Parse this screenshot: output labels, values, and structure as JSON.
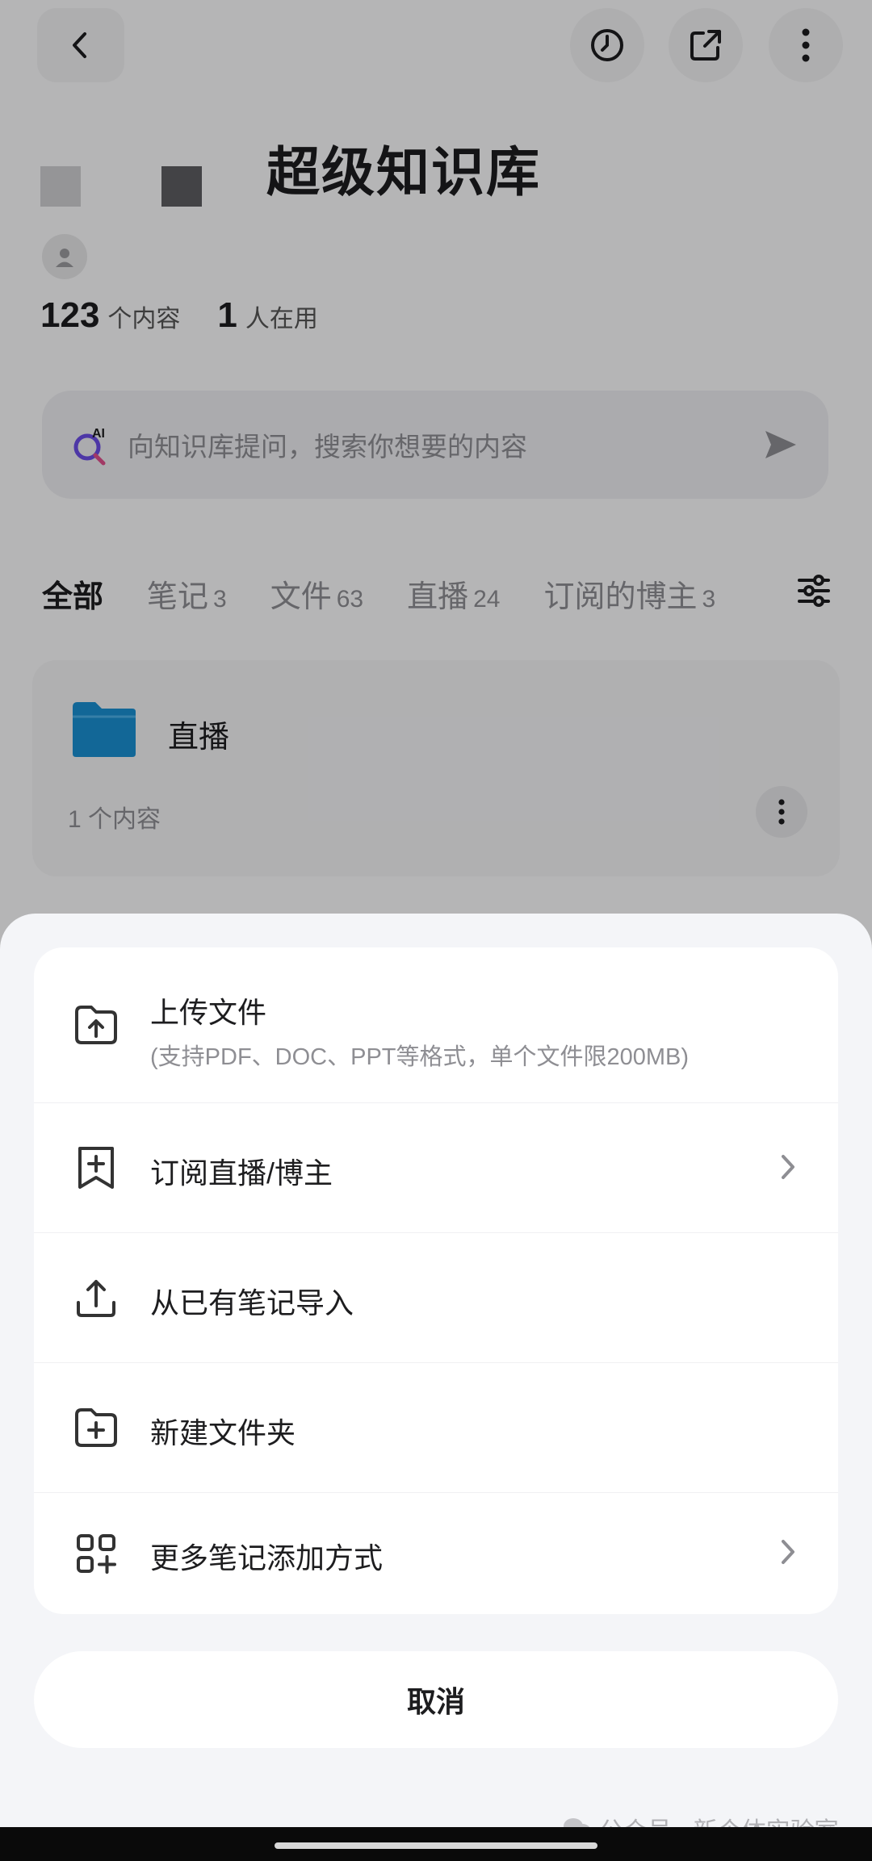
{
  "header": {
    "title": "超级知识库",
    "icons": [
      "back-icon",
      "history-icon",
      "share-icon",
      "more-icon"
    ]
  },
  "stats": {
    "content_count": "123",
    "content_label": "个内容",
    "user_count": "1",
    "user_label": "人在用"
  },
  "search": {
    "ai_label": "AI",
    "placeholder": "向知识库提问，搜索你想要的内容"
  },
  "tabs": [
    {
      "label": "全部",
      "count": "",
      "active": true
    },
    {
      "label": "笔记",
      "count": "3"
    },
    {
      "label": "文件",
      "count": "63"
    },
    {
      "label": "直播",
      "count": "24"
    },
    {
      "label": "订阅的博主",
      "count": "3"
    }
  ],
  "folder": {
    "name": "直播",
    "count_text": "1 个内容",
    "color": "#1a8fd1"
  },
  "sheet": {
    "items": [
      {
        "label": "上传文件",
        "sub": "(支持PDF、DOC、PPT等格式，单个文件限200MB)"
      },
      {
        "label": "订阅直播/博主"
      },
      {
        "label": "从已有笔记导入"
      },
      {
        "label": "新建文件夹"
      },
      {
        "label": "更多笔记添加方式"
      }
    ],
    "cancel": "取消"
  },
  "watermark": "公众号 · 新个体实验室"
}
